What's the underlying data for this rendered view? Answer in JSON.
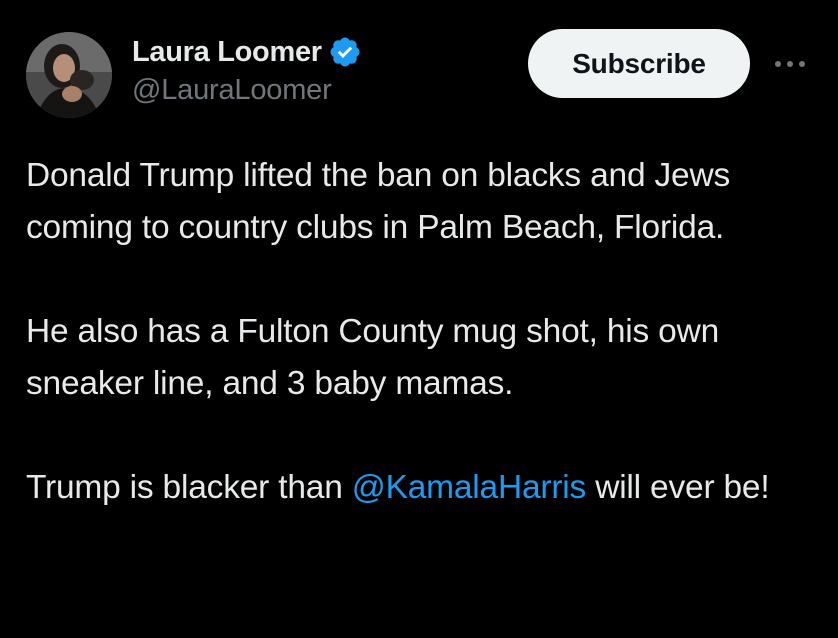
{
  "author": {
    "display_name": "Laura Loomer",
    "handle": "@LauraLoomer",
    "verified_icon": "verified-badge-icon"
  },
  "actions": {
    "subscribe_label": "Subscribe",
    "more_icon": "more-horizontal-icon"
  },
  "tweet": {
    "paragraph_1": "Donald Trump lifted the ban on blacks and Jews coming to country clubs in Palm Beach, Florida.",
    "paragraph_2": "He also has a Fulton County mug shot, his own sneaker line, and 3 baby mamas.",
    "paragraph_3_before": "Trump is blacker than ",
    "paragraph_3_mention": "@KamalaHarris",
    "paragraph_3_after": " will ever be!"
  },
  "colors": {
    "background": "#000000",
    "text": "#e7e9ea",
    "secondary_text": "#71767b",
    "link": "#1d9bf0",
    "button_bg": "#eff3f4",
    "verified": "#1d9bf0"
  }
}
